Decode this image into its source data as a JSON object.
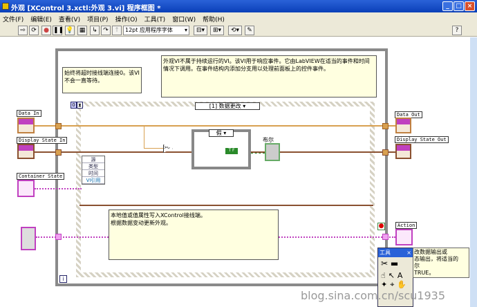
{
  "window": {
    "title": "外观 [XControl 3.xctl:外观 3.vi] 程序框图 *",
    "buttons": [
      "minimize",
      "maximize",
      "close"
    ]
  },
  "menu": [
    "文件(F)",
    "编辑(E)",
    "查看(V)",
    "项目(P)",
    "操作(O)",
    "工具(T)",
    "窗口(W)",
    "帮助(H)"
  ],
  "toolbar": {
    "font": "12pt 应用程序字体",
    "icons": [
      "run-arrow-icon",
      "run-continuous-icon",
      "abort-icon",
      "pause-icon",
      "highlight-execution-icon",
      "retain-wire-values-icon",
      "step-into-icon",
      "step-over-icon",
      "step-out-icon",
      "align-icon",
      "distribute-icon",
      "reorder-icon",
      "cleanup-icon",
      "help-icon"
    ]
  },
  "comments": {
    "timeout": "始终将超时接线端连接0。该VI不会一直等待。",
    "main": "外观VI不属于持续运行的VI。该VI用于响应事件。它由LabVIEW在适当的事件和时间情况下调用。在事件结构内添加分支用以处理前面板上的控件事件。",
    "bottom": "本地值或值属性写入XControl接线端。\n根据数据变动更新外观。"
  },
  "event": {
    "timeout_const": "0",
    "case_selector": "[1] 数据更改",
    "data_node": [
      "源",
      "类型",
      "时间",
      "VI引用"
    ]
  },
  "case": {
    "selector": "假",
    "const": "T F"
  },
  "terminals": {
    "data_in": "Data In",
    "display_in": "Display State In",
    "container": "Container State",
    "data_out": "Data Out",
    "display_out": "Display State Out",
    "action": "Action",
    "bool": "布尔"
  },
  "loop": {
    "iteration": "i"
  },
  "palette": {
    "title": "工具"
  },
  "tooltip": "改数据输出或\n态输出，将适当的\n尔\nTRUE。",
  "watermark": "blog.sina.com.cn/scu1935",
  "colors": {
    "title_bar": "#0a3fb8",
    "comment_bg": "#ffffe0",
    "cluster_wire": "#c040c0",
    "variant_wire": "#d8a050",
    "bool_wire": "#208020"
  }
}
